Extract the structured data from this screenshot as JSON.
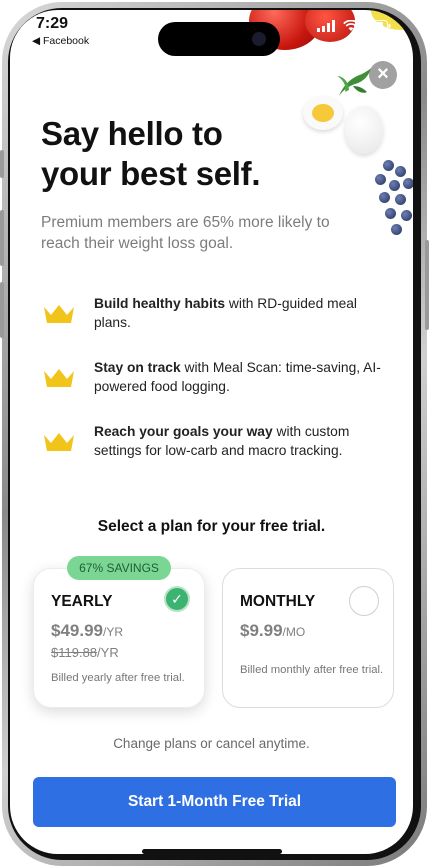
{
  "status_bar": {
    "time": "7:29",
    "back_app": "◀ Facebook"
  },
  "close_label": "×",
  "headline": "Say hello to\nyour best self.",
  "subhead": "Premium members are 65% more likely to reach their weight loss goal.",
  "features": [
    {
      "bold": "Build healthy habits",
      "rest": " with RD-guided meal plans.",
      "icon": "crown-icon"
    },
    {
      "bold": "Stay on track",
      "rest": " with Meal Scan: time-saving, AI-powered food logging.",
      "icon": "crown-icon"
    },
    {
      "bold": "Reach your goals your way",
      "rest": " with custom settings for low-carb and macro tracking.",
      "icon": "crown-icon"
    }
  ],
  "select_title": "Select a plan for your free trial.",
  "plans": {
    "yearly": {
      "badge": "67% SAVINGS",
      "name": "YEARLY",
      "price": "$49.99",
      "per": "/YR",
      "old_price": "$119.88",
      "old_per": "/YR",
      "billing": "Billed yearly after free trial.",
      "selected": true
    },
    "monthly": {
      "name": "MONTHLY",
      "price": "$9.99",
      "per": "/MO",
      "billing": "Billed monthly after free trial.",
      "selected": false
    }
  },
  "change_note": "Change plans or cancel anytime.",
  "cta_label": "Start 1-Month Free Trial",
  "colors": {
    "accent": "#2f6fe4",
    "crown": "#f0c419",
    "badge": "#7bd694",
    "check": "#3cb371"
  }
}
